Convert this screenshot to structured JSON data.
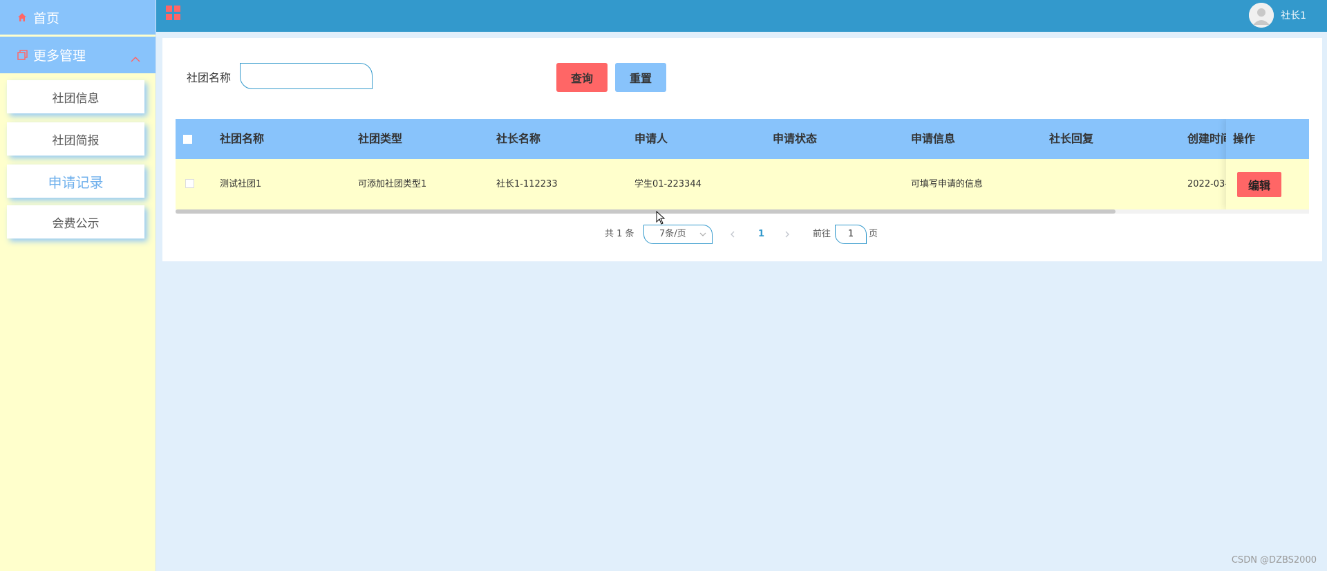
{
  "sidebar": {
    "home_label": "首页",
    "more_label": "更多管理",
    "items": [
      {
        "label": "社团信息"
      },
      {
        "label": "社团简报"
      },
      {
        "label": "申请记录",
        "active": true
      },
      {
        "label": "会费公示"
      }
    ],
    "icons": {
      "home": "home-icon",
      "more": "copy-icon",
      "chevron": "chevron-up-icon"
    }
  },
  "header": {
    "user_name": "社长1",
    "icons": {
      "menu": "grid-icon",
      "avatar": "user-avatar-icon"
    }
  },
  "search": {
    "label": "社团名称",
    "value": "",
    "query_label": "查询",
    "reset_label": "重置"
  },
  "table": {
    "columns": [
      "社团名称",
      "社团类型",
      "社长名称",
      "申请人",
      "申请状态",
      "申请信息",
      "社长回复",
      "创建时间",
      "操作"
    ],
    "rows": [
      {
        "name": "测试社团1",
        "type": "可添加社团类型1",
        "president": "社长1-112233",
        "applicant": "学生01-223344",
        "status": "",
        "info": "可填写申请的信息",
        "reply": "",
        "created": "2022-03-",
        "action_label": "编辑"
      }
    ]
  },
  "pagination": {
    "total_text": "共 1 条",
    "page_size": "7条/页",
    "current_page": "1",
    "goto_prefix": "前往",
    "goto_value": "1",
    "goto_suffix": "页"
  },
  "watermark": "CSDN @DZBS2000",
  "colors": {
    "header": "#3399cc",
    "sidebar_bg": "#ffffcc",
    "menu_bg": "#88c3fb",
    "table_head": "#88c3fb",
    "row_bg": "#ffffcc",
    "danger": "#ff6666",
    "page_bg": "#e1effb"
  }
}
